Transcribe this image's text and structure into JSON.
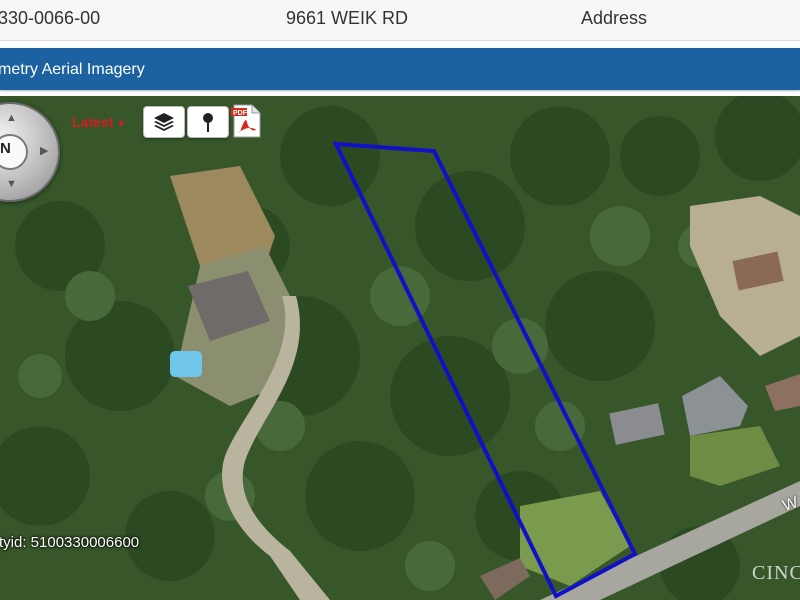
{
  "record": {
    "parcel_number": "330-0066-00",
    "address": "9661 WEIK RD",
    "type": "Address"
  },
  "section": {
    "title": "metry Aerial Imagery"
  },
  "map": {
    "compass_label": "N",
    "imagery_select": "Latest",
    "icons": [
      "compass-icon",
      "layers-icon",
      "pin-icon",
      "pdf-icon"
    ],
    "parcel_id_label": "tyid: 5100330006600",
    "road_label": "W",
    "watermark": "CINC",
    "parcel_outline_color": "#1010c8"
  },
  "colors": {
    "band": "#1c62a0",
    "latest": "#d41e1e"
  }
}
